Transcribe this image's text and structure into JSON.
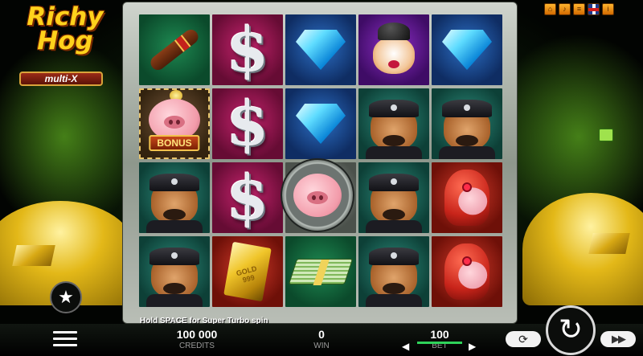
{
  "game": {
    "logo_title": "Richy Hog",
    "logo_subtitle": "multi-X"
  },
  "top_icons": [
    "home-icon",
    "sound-icon",
    "history-icon",
    "language-flag-icon",
    "info-icon"
  ],
  "reels": [
    [
      "cigar",
      "dollar",
      "diamond",
      "fox-bowler-hat",
      "diamond"
    ],
    [
      "piggy-bank-bonus",
      "dollar",
      "diamond",
      "bulldog-cop",
      "bulldog-cop"
    ],
    [
      "bulldog-cop",
      "dollar",
      "pig-wild",
      "bulldog-cop",
      "lady-pig"
    ],
    [
      "bulldog-cop",
      "gold-bar",
      "money-stack",
      "bulldog-cop",
      "lady-pig"
    ]
  ],
  "bonus_label": "BONUS",
  "gold_bar_text": "GOLD\n999",
  "hint_text": "Hold SPACE for Super Turbo spin",
  "bottom_bar": {
    "credits_value": "100 000",
    "credits_label": "CREDITS",
    "win_value": "0",
    "win_label": "WIN",
    "bet_value": "100",
    "bet_label": "BET"
  },
  "buttons": {
    "menu": "menu-icon",
    "favorites": "star-icon",
    "spin": "spin-icon",
    "autoplay": "autoplay-icon",
    "turbo": "turbo-icon"
  },
  "colors": {
    "accent_green": "#2fd35a",
    "logo_gold": "#ffd21c"
  }
}
